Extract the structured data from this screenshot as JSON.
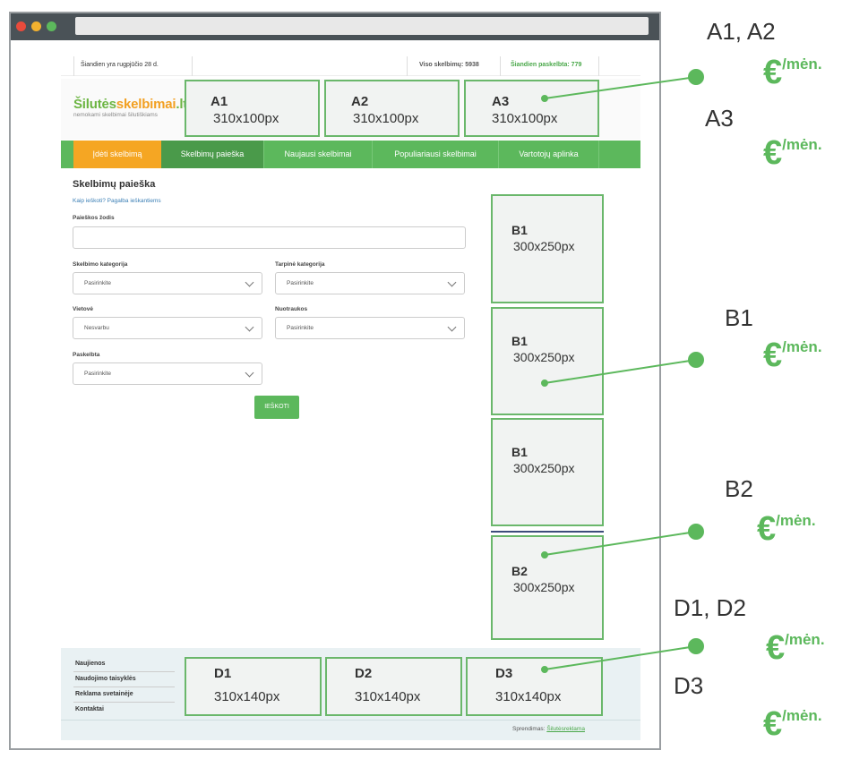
{
  "topbar": {
    "date": "Šiandien yra rugpjūčio 28 d.",
    "total": "Viso skelbimų: 5938",
    "today": "Šiandien paskelbta: 779"
  },
  "logo": {
    "part1": "Šilutės",
    "part2": "skelbimai",
    "part3": ".lt",
    "tagline": "nemokami skelbimai šilutiškiams"
  },
  "ads_top": [
    {
      "name": "A1",
      "size": "310x100px"
    },
    {
      "name": "A2",
      "size": "310x100px"
    },
    {
      "name": "A3",
      "size": "310x100px"
    }
  ],
  "nav": [
    "Įdėti skelbimą",
    "Skelbimų paieška",
    "Naujausi skelbimai",
    "Populiariausi skelbimai",
    "Vartotojų aplinka"
  ],
  "search": {
    "title": "Skelbimų paieška",
    "help": "Kaip ieškoti? Pagalba ieškantiems",
    "keyword_label": "Paieškos žodis",
    "category_label": "Skelbimo kategorija",
    "category_value": "Pasirinkite",
    "subcategory_label": "Tarpinė kategorija",
    "subcategory_value": "Pasirinkite",
    "location_label": "Vietovė",
    "location_value": "Nesvarbu",
    "photos_label": "Nuotraukos",
    "photos_value": "Pasirinkite",
    "published_label": "Paskelbta",
    "published_value": "Pasirinkite",
    "button": "IEŠKOTI"
  },
  "ads_side": [
    {
      "name": "B1",
      "size": "300x250px"
    },
    {
      "name": "B1",
      "size": "300x250px"
    },
    {
      "name": "B1",
      "size": "300x250px"
    },
    {
      "name": "B2",
      "size": "300x250px"
    }
  ],
  "footer": {
    "links": [
      "Naujienos",
      "Naudojimo taisyklės",
      "Reklama svetainėje",
      "Kontaktai"
    ],
    "credit_label": "Sprendimas:",
    "credit_link": "Šilutėsreklama"
  },
  "ads_bottom": [
    {
      "name": "D1",
      "size": "310x140px"
    },
    {
      "name": "D2",
      "size": "310x140px"
    },
    {
      "name": "D3",
      "size": "310x140px"
    }
  ],
  "annotations": {
    "a12": "A1, A2",
    "a3": "A3",
    "b1": "B1",
    "b2": "B2",
    "d12": "D1, D2",
    "d3": "D3",
    "euro": "€",
    "per_month": "/mėn."
  },
  "colors": {
    "green": "#5cb85c",
    "orange": "#f5a623",
    "ad_border": "#6ab76b"
  }
}
